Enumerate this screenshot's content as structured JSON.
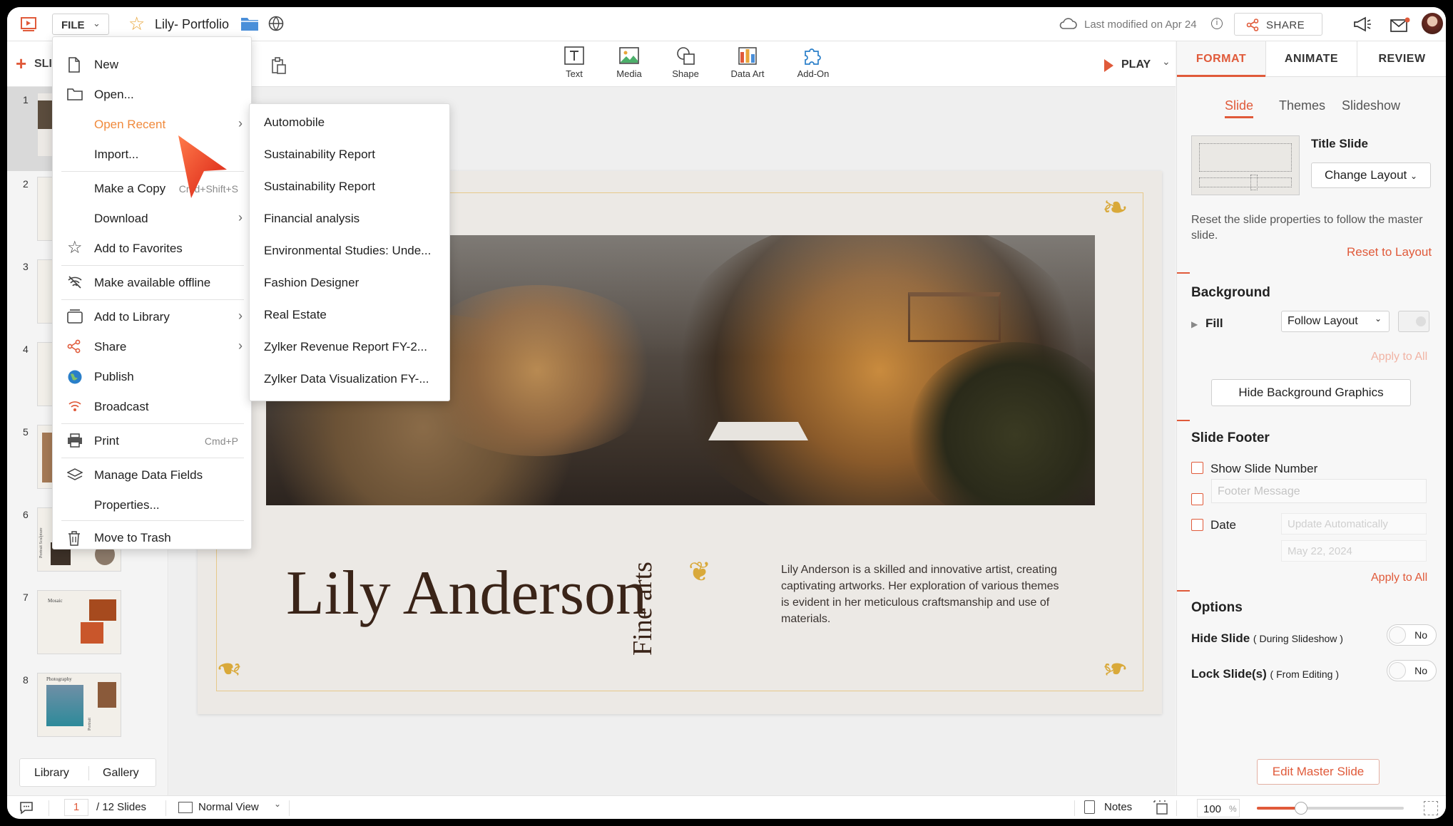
{
  "app": {
    "doc_title": "Lily- Portfolio",
    "file_button": "FILE",
    "last_modified": "Last modified on Apr 24",
    "share": "SHARE",
    "add_slide": "SLI"
  },
  "toolbar": {
    "text": "Text",
    "media": "Media",
    "shape": "Shape",
    "data_art": "Data Art",
    "add_on": "Add-On",
    "play": "PLAY"
  },
  "file_menu": {
    "items": [
      {
        "label": "New",
        "icon": "new-file-icon"
      },
      {
        "label": "Open...",
        "icon": "folder-icon"
      },
      {
        "label": "Open Recent",
        "icon": "",
        "highlight": true
      },
      {
        "label": "Import...",
        "icon": ""
      },
      {
        "label": "Make a Copy",
        "shortcut": "Cmd+Shift+S"
      },
      {
        "label": "Download"
      },
      {
        "label": "Add to Favorites",
        "icon": "star-icon"
      },
      {
        "label": "Make available offline",
        "icon": "offline-icon"
      },
      {
        "label": "Add to Library",
        "icon": "library-icon"
      },
      {
        "label": "Share",
        "icon": "share-icon"
      },
      {
        "label": "Publish",
        "icon": "globe-icon"
      },
      {
        "label": "Broadcast",
        "icon": "broadcast-icon"
      },
      {
        "label": "Print",
        "icon": "print-icon",
        "shortcut": "Cmd+P"
      },
      {
        "label": "Manage Data Fields",
        "icon": "layers-icon"
      },
      {
        "label": "Properties..."
      },
      {
        "label": "Move to Trash",
        "icon": "trash-icon"
      }
    ],
    "accent": "#f08a3c"
  },
  "recent_menu": [
    "Automobile",
    "Sustainability Report",
    "Sustainability Report",
    "Financial analysis",
    "Environmental Studies: Unde...",
    "Fashion Designer",
    "Real Estate",
    "Zylker Revenue Report FY-2...",
    "Zylker Data Visualization FY-..."
  ],
  "slides": {
    "numbers": [
      "1",
      "2",
      "3",
      "4",
      "5",
      "6",
      "7",
      "8"
    ],
    "thumb7_title": "Mosaic",
    "thumb8_title": "Photography",
    "thumb8_side": "Portrait",
    "thumb6_side": "Portrait Sculpture"
  },
  "slide": {
    "name": "Lily Anderson",
    "vertical": "Fine arts",
    "body": "Lily Anderson is a skilled and innovative artist, creating captivating artworks. Her exploration of various themes is evident in her meticulous craftsmanship and use of materials."
  },
  "right_panel": {
    "tabs": [
      "FORMAT",
      "ANIMATE",
      "REVIEW"
    ],
    "subtabs": [
      "Slide",
      "Themes",
      "Slideshow"
    ],
    "layout_name": "Title Slide",
    "change_layout": "Change Layout",
    "reset_desc": "Reset the slide properties to follow the master slide.",
    "reset_link": "Reset to Layout",
    "background": "Background",
    "fill": "Fill",
    "fill_value": "Follow Layout",
    "apply_all": "Apply to All",
    "hide_bg": "Hide Background Graphics",
    "footer_title": "Slide Footer",
    "show_slide_number": "Show Slide Number",
    "footer_placeholder": "Footer Message",
    "date": "Date",
    "date_mode": "Update Automatically",
    "date_value": "May 22, 2024",
    "apply_all_2": "Apply to All",
    "options": "Options",
    "hide_slide": "Hide Slide",
    "hide_slide_hint": "( During Slideshow )",
    "lock_slide": "Lock Slide(s)",
    "lock_slide_hint": "( From Editing )",
    "no": "No",
    "edit_master": "Edit Master Slide",
    "accent": "#e05a3a"
  },
  "bottom": {
    "library": "Library",
    "gallery": "Gallery",
    "page": "1",
    "total": "/ 12 Slides",
    "view": "Normal View",
    "notes": "Notes",
    "zoom": "100",
    "zoom_unit": "%",
    "zoom_level": 0.3
  }
}
